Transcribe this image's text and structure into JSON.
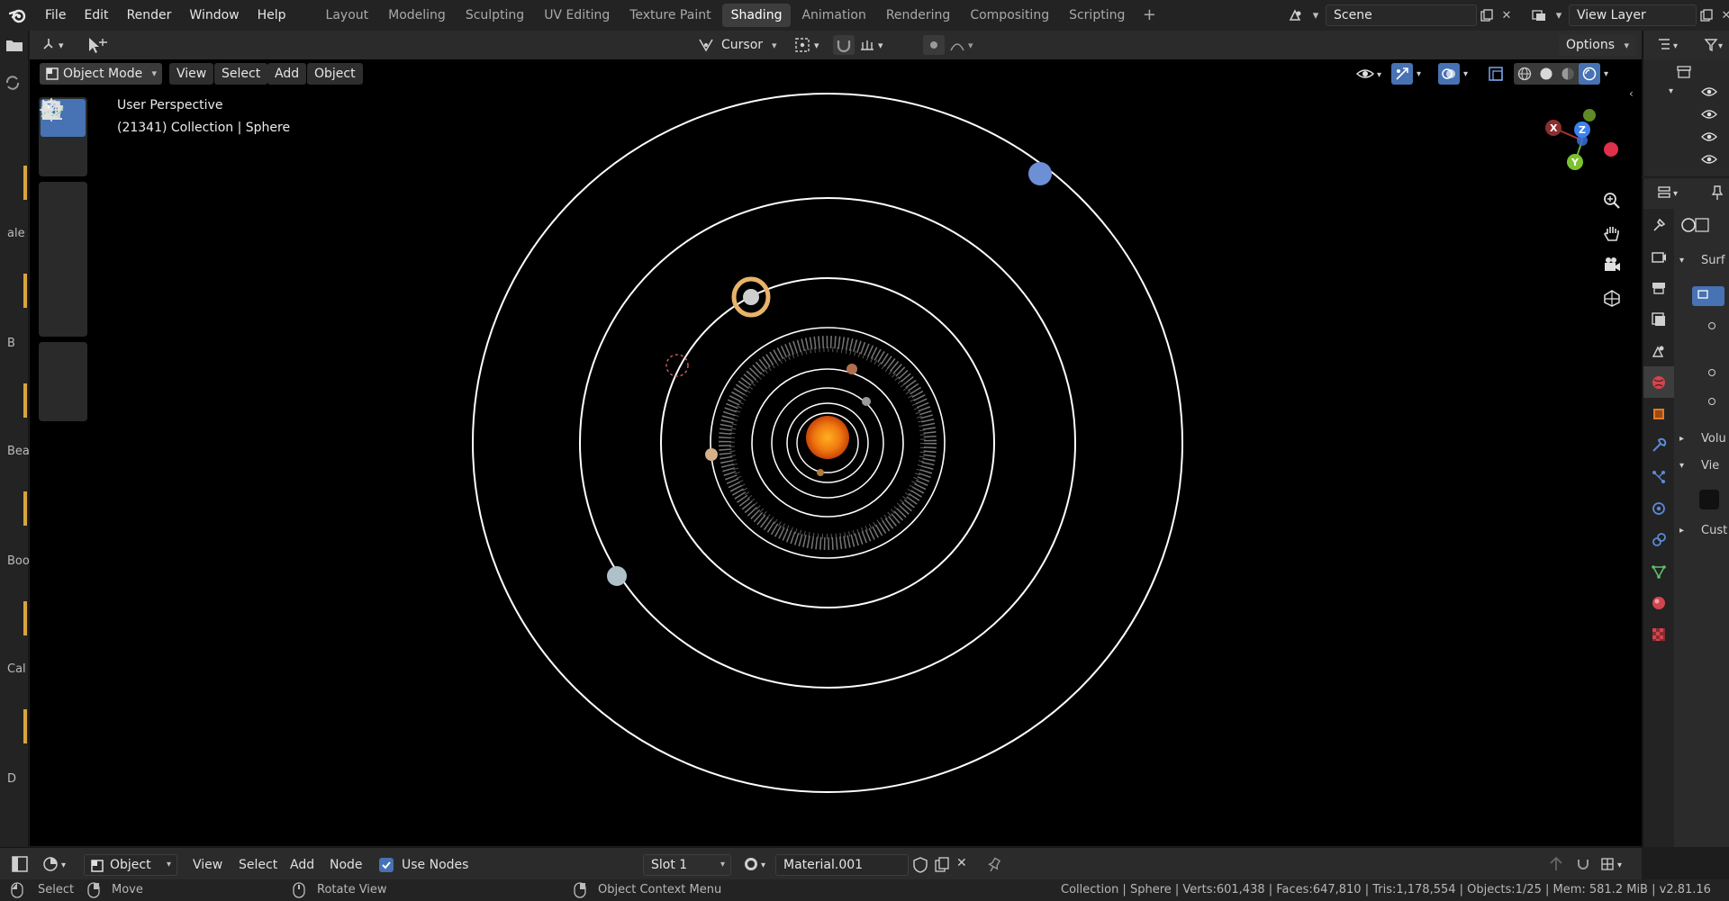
{
  "topbar": {
    "menus": [
      "File",
      "Edit",
      "Render",
      "Window",
      "Help"
    ],
    "tabs": [
      "Layout",
      "Modeling",
      "Sculpting",
      "UV Editing",
      "Texture Paint",
      "Shading",
      "Animation",
      "Rendering",
      "Compositing",
      "Scripting"
    ],
    "active_tab": "Shading",
    "scene_name": "Scene",
    "view_layer": "View Layer"
  },
  "leftstrip": {
    "labels": [
      "ale",
      "B",
      "Bea",
      "Boo",
      "Cal",
      "D"
    ]
  },
  "viewport_header": {
    "transform_orientation": "Cursor",
    "options": "Options",
    "mode": "Object Mode",
    "menus": [
      "View",
      "Select",
      "Add",
      "Object"
    ]
  },
  "viewport": {
    "perspective_label": "User Perspective",
    "collection_label": "(21341) Collection | Sphere",
    "gizmo": {
      "x": "X",
      "y": "Y",
      "z": "Z"
    }
  },
  "properties": {
    "sections": [
      "Surf",
      "Volu",
      "Vie",
      "Cust"
    ]
  },
  "shader_header": {
    "object_type": "Object",
    "menus": [
      "View",
      "Select",
      "Add",
      "Node"
    ],
    "use_nodes_label": "Use Nodes",
    "use_nodes": true,
    "slot": "Slot 1",
    "material": "Material.001"
  },
  "statusbar": {
    "select": "Select",
    "move": "Move",
    "rotate": "Rotate View",
    "context": "Object Context Menu",
    "stats": "Collection | Sphere | Verts:601,438 | Faces:647,810 | Tris:1,178,554 | Objects:1/25 | Mem: 581.2 MiB | v2.81.16"
  },
  "colors": {
    "accent": "#4772b3",
    "sun": "#f07a10",
    "orbit": "#ffffff",
    "background": "#000000"
  }
}
